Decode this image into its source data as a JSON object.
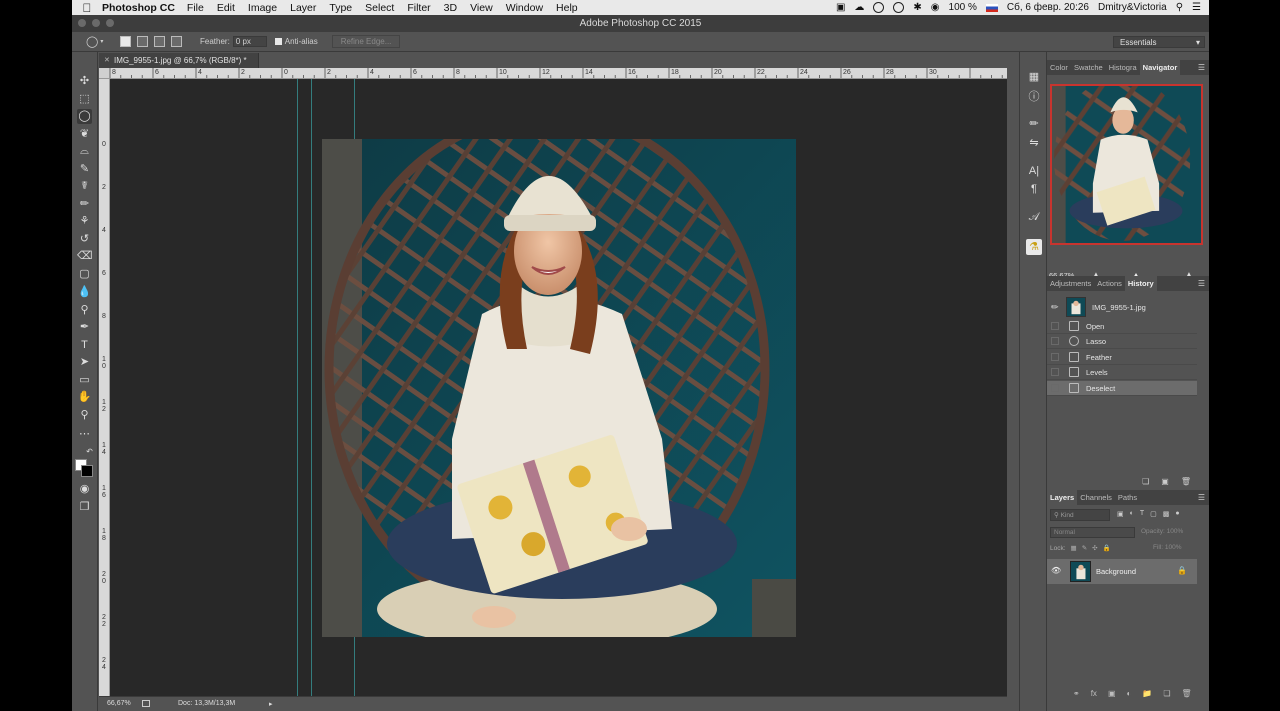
{
  "menubar": {
    "app_name": "Photoshop CC",
    "menus": [
      "File",
      "Edit",
      "Image",
      "Layer",
      "Type",
      "Select",
      "Filter",
      "3D",
      "View",
      "Window",
      "Help"
    ],
    "battery": "100 %",
    "datetime": "Сб, 6 февр.  20:26",
    "user": "Dmitry&Victoria"
  },
  "window": {
    "title": "Adobe Photoshop CC 2015"
  },
  "options_bar": {
    "feather_label": "Feather:",
    "feather_value": "0 px",
    "anti_alias_label": "Anti-alias",
    "anti_alias_checked": true,
    "refine_edge_label": "Refine Edge...",
    "workspace": "Essentials"
  },
  "document": {
    "tab_title": "IMG_9955-1.jpg @ 66,7% (RGB/8*) *",
    "zoom": "66,67%",
    "doc_size": "Doc: 13,3M/13,3M",
    "ruler_h": [
      "8",
      "6",
      "4",
      "2",
      "0",
      "2",
      "4",
      "6",
      "8",
      "10",
      "12",
      "14",
      "16",
      "18",
      "20",
      "22",
      "24",
      "26",
      "28",
      "30"
    ],
    "ruler_v": [
      "0",
      "2",
      "4",
      "6",
      "8",
      "1\n0",
      "1\n2",
      "1\n4",
      "1\n6",
      "1\n8",
      "2\n0",
      "2\n2",
      "2\n4"
    ]
  },
  "tools": [
    "move-icon",
    "marquee-icon",
    "lasso-icon",
    "quick-select-icon",
    "crop-icon",
    "eyedropper-icon",
    "healing-icon",
    "brush-icon",
    "stamp-icon",
    "history-brush-icon",
    "eraser-icon",
    "gradient-icon",
    "blur-icon",
    "dodge-icon",
    "pen-icon",
    "type-icon",
    "path-select-icon",
    "rectangle-icon",
    "hand-icon",
    "zoom-icon"
  ],
  "navigator": {
    "tabs": [
      "Color",
      "Swatche",
      "Histogra",
      "Navigator"
    ],
    "active_tab": "Navigator",
    "zoom": "66,67%"
  },
  "history": {
    "tabs": [
      "Adjustments",
      "Actions",
      "History"
    ],
    "active_tab": "History",
    "snapshot": "IMG_9955-1.jpg",
    "steps": [
      "Open",
      "Lasso",
      "Feather",
      "Levels",
      "Deselect"
    ],
    "selected_step": "Deselect"
  },
  "layers": {
    "tabs": [
      "Layers",
      "Channels",
      "Paths"
    ],
    "active_tab": "Layers",
    "search_placeholder": "Kind",
    "blend_mode": "Normal",
    "opacity_label": "Opacity:",
    "opacity_value": "100%",
    "lock_label": "Lock:",
    "fill_label": "Fill:",
    "fill_value": "100%",
    "items": [
      {
        "name": "Background",
        "visible": true,
        "locked": true
      }
    ]
  },
  "colors": {
    "accent": "#3ec3c4",
    "panel_bg": "#535353",
    "canvas_bg": "#282828",
    "selection": "#6c6c6c",
    "nav_box": "#c8342e"
  }
}
